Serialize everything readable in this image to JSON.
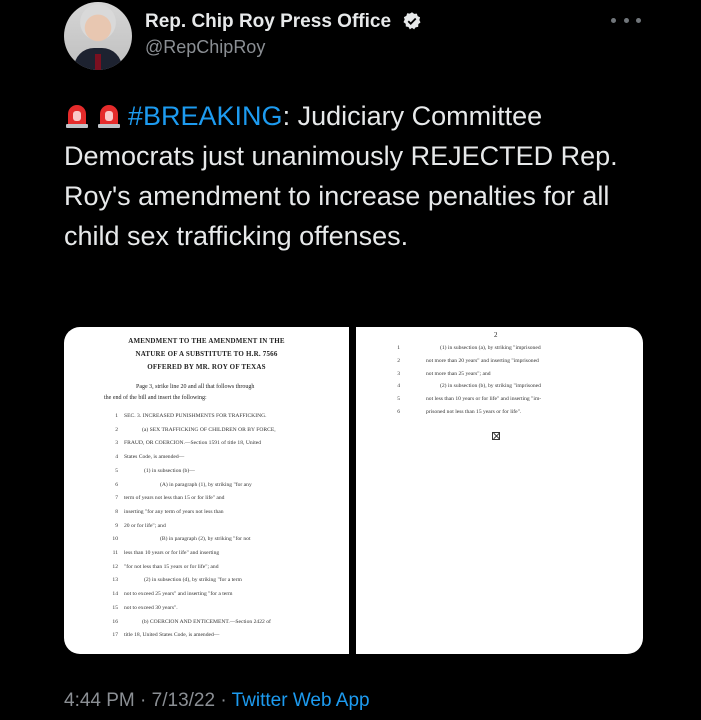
{
  "author": {
    "display_name": "Rep. Chip Roy Press Office",
    "handle": "@RepChipRoy"
  },
  "tweet": {
    "hashtag": "#BREAKING",
    "text": ": Judiciary Committee Democrats just unanimously REJECTED Rep. Roy's amendment to increase penalties for all child sex trafficking offenses."
  },
  "document_page1": {
    "title_lines": [
      "AMENDMENT TO THE AMENDMENT IN THE",
      "NATURE OF A SUBSTITUTE TO H.R. 7566",
      "OFFERED BY MR. ROY OF TEXAS"
    ],
    "intro_lines": [
      "Page 3, strike line 20 and all that follows through",
      "the end of the bill and insert the following:"
    ],
    "lines": [
      {
        "n": "1",
        "t": "SEC. 3. INCREASED PUNISHMENTS FOR TRAFFICKING."
      },
      {
        "n": "2",
        "t": "(a) SEX TRAFFICKING OF CHILDREN OR BY FORCE,"
      },
      {
        "n": "3",
        "t": "FRAUD, OR COERCION.—Section 1591 of title 18, United"
      },
      {
        "n": "4",
        "t": "States Code, is amended—"
      },
      {
        "n": "5",
        "t": "(1) in subsection (b)—"
      },
      {
        "n": "6",
        "t": "(A) in paragraph (1), by striking \"for any"
      },
      {
        "n": "7",
        "t": "term of years not less than 15 or for life\" and"
      },
      {
        "n": "8",
        "t": "inserting \"for any term of years not less than"
      },
      {
        "n": "9",
        "t": "20 or for life\"; and"
      },
      {
        "n": "10",
        "t": "(B) in paragraph (2), by striking \"for not"
      },
      {
        "n": "11",
        "t": "less than 10 years or for life\" and inserting"
      },
      {
        "n": "12",
        "t": "\"for not less than 15 years or for life\"; and"
      },
      {
        "n": "13",
        "t": "(2) in subsection (d), by striking \"for a term"
      },
      {
        "n": "14",
        "t": "not to exceed 25 years\" and inserting \"for a term"
      },
      {
        "n": "15",
        "t": "not to exceed 30 years\"."
      },
      {
        "n": "16",
        "t": "(b) COERCION AND ENTICEMENT.—Section 2422 of"
      },
      {
        "n": "17",
        "t": "title 18, United States Code, is amended—"
      }
    ]
  },
  "document_page2": {
    "page_number": "2",
    "lines": [
      {
        "n": "1",
        "t": "(1) in subsection (a), by striking \"imprisoned"
      },
      {
        "n": "2",
        "t": "not more than 20 years\" and inserting \"imprisoned"
      },
      {
        "n": "3",
        "t": "not more than 25 years\"; and"
      },
      {
        "n": "4",
        "t": "(2) in subsection (b), by striking \"imprisoned"
      },
      {
        "n": "5",
        "t": "not less than 10 years or for life\" and inserting \"im-"
      },
      {
        "n": "6",
        "t": "prisoned not less than 15 years or for life\"."
      }
    ]
  },
  "meta": {
    "time": "4:44 PM",
    "separator": " · ",
    "date": "7/13/22",
    "source": "Twitter Web App"
  },
  "colors": {
    "background": "#000000",
    "text": "#e7e9ea",
    "muted": "#8b8f94",
    "link": "#1d9bf0",
    "verified": "#e7e9ea"
  },
  "icons": [
    "verified-badge-icon",
    "more-options-icon",
    "police-siren-emoji"
  ]
}
